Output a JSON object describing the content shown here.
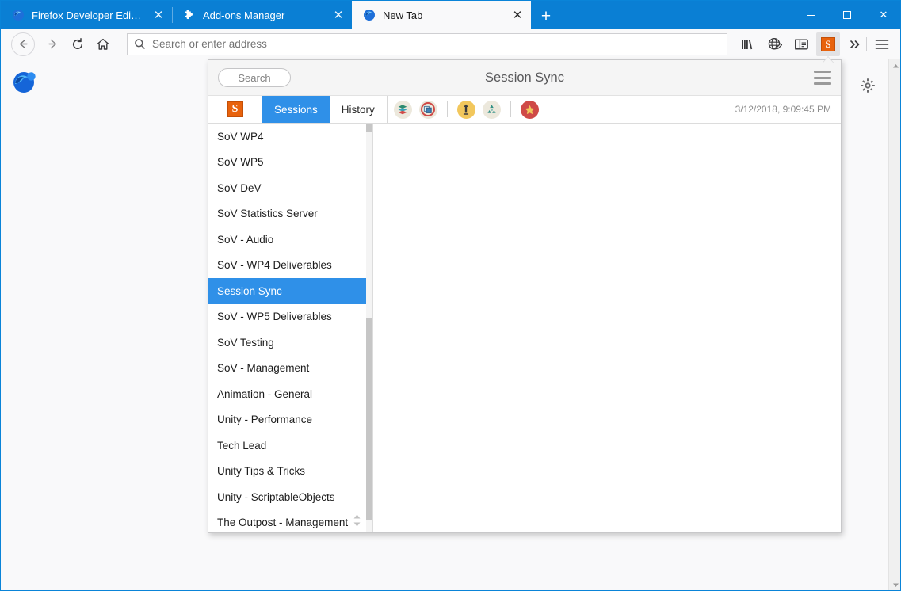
{
  "window": {
    "controls": {
      "minimize": "–",
      "maximize": "□",
      "close": "✕"
    }
  },
  "tabs": [
    {
      "title": "Firefox Developer Edition",
      "icon": "firefox-icon",
      "close": "✕",
      "active": false
    },
    {
      "title": "Add-ons Manager",
      "icon": "puzzle-icon",
      "close": "✕",
      "active": false
    },
    {
      "title": "New Tab",
      "icon": "firefox-icon",
      "close": "✕",
      "active": true
    }
  ],
  "new_tab_button": "+",
  "navbar": {
    "back": "←",
    "forward": "→",
    "reload": "↻",
    "home": "⌂",
    "urlbar_placeholder": "Search or enter address",
    "urlbar_value": "",
    "icons": [
      {
        "name": "library-icon",
        "glyph": "|||\\"
      },
      {
        "name": "container-tabs-icon",
        "glyph": "globe"
      },
      {
        "name": "sidebar-toggle-icon",
        "glyph": "sidebar"
      },
      {
        "name": "session-sync-extension-icon",
        "glyph": "S"
      },
      {
        "name": "overflow-chevron-icon",
        "glyph": "»"
      },
      {
        "name": "app-menu-icon",
        "glyph": "☰"
      }
    ]
  },
  "page": {
    "gear_label": "⚙",
    "scroll_up": "▲",
    "scroll_down": "▼"
  },
  "popup": {
    "search_placeholder": "Search",
    "title": "Session Sync",
    "menu_label": "☰",
    "brand": "S",
    "tabs": [
      {
        "label": "Sessions",
        "selected": true
      },
      {
        "label": "History",
        "selected": false
      }
    ],
    "actions": [
      {
        "name": "save-session-icon",
        "title": "Save Session"
      },
      {
        "name": "save-window-icon",
        "title": "Save Window"
      },
      {
        "name": "restore-session-icon",
        "title": "Restore"
      },
      {
        "name": "recycle-icon",
        "title": "Recycle"
      },
      {
        "name": "bookmarks-star-icon",
        "title": "Bookmarks"
      }
    ],
    "timestamp": "3/12/2018, 9:09:45 PM",
    "sessions": [
      {
        "label": "SoV WP4",
        "selected": false
      },
      {
        "label": "SoV WP5",
        "selected": false
      },
      {
        "label": "SoV DeV",
        "selected": false
      },
      {
        "label": "SoV Statistics Server",
        "selected": false
      },
      {
        "label": "SoV - Audio",
        "selected": false
      },
      {
        "label": "SoV - WP4 Deliverables",
        "selected": false
      },
      {
        "label": "Session Sync",
        "selected": true
      },
      {
        "label": "SoV - WP5 Deliverables",
        "selected": false
      },
      {
        "label": "SoV Testing",
        "selected": false
      },
      {
        "label": "SoV - Management",
        "selected": false
      },
      {
        "label": "Animation - General",
        "selected": false
      },
      {
        "label": "Unity - Performance",
        "selected": false
      },
      {
        "label": "Tech Lead",
        "selected": false
      },
      {
        "label": "Unity Tips & Tricks",
        "selected": false
      },
      {
        "label": "Unity - ScriptableObjects",
        "selected": false
      },
      {
        "label": "The Outpost - Management",
        "selected": false
      }
    ],
    "resize_grip": "▴▾"
  },
  "colors": {
    "tabstrip_blue": "#0a7fd4",
    "accent_blue": "#2f90e8",
    "extension_orange": "#e8620c",
    "star_red": "#cf4a47",
    "restore_yellow": "#f2c75c"
  }
}
